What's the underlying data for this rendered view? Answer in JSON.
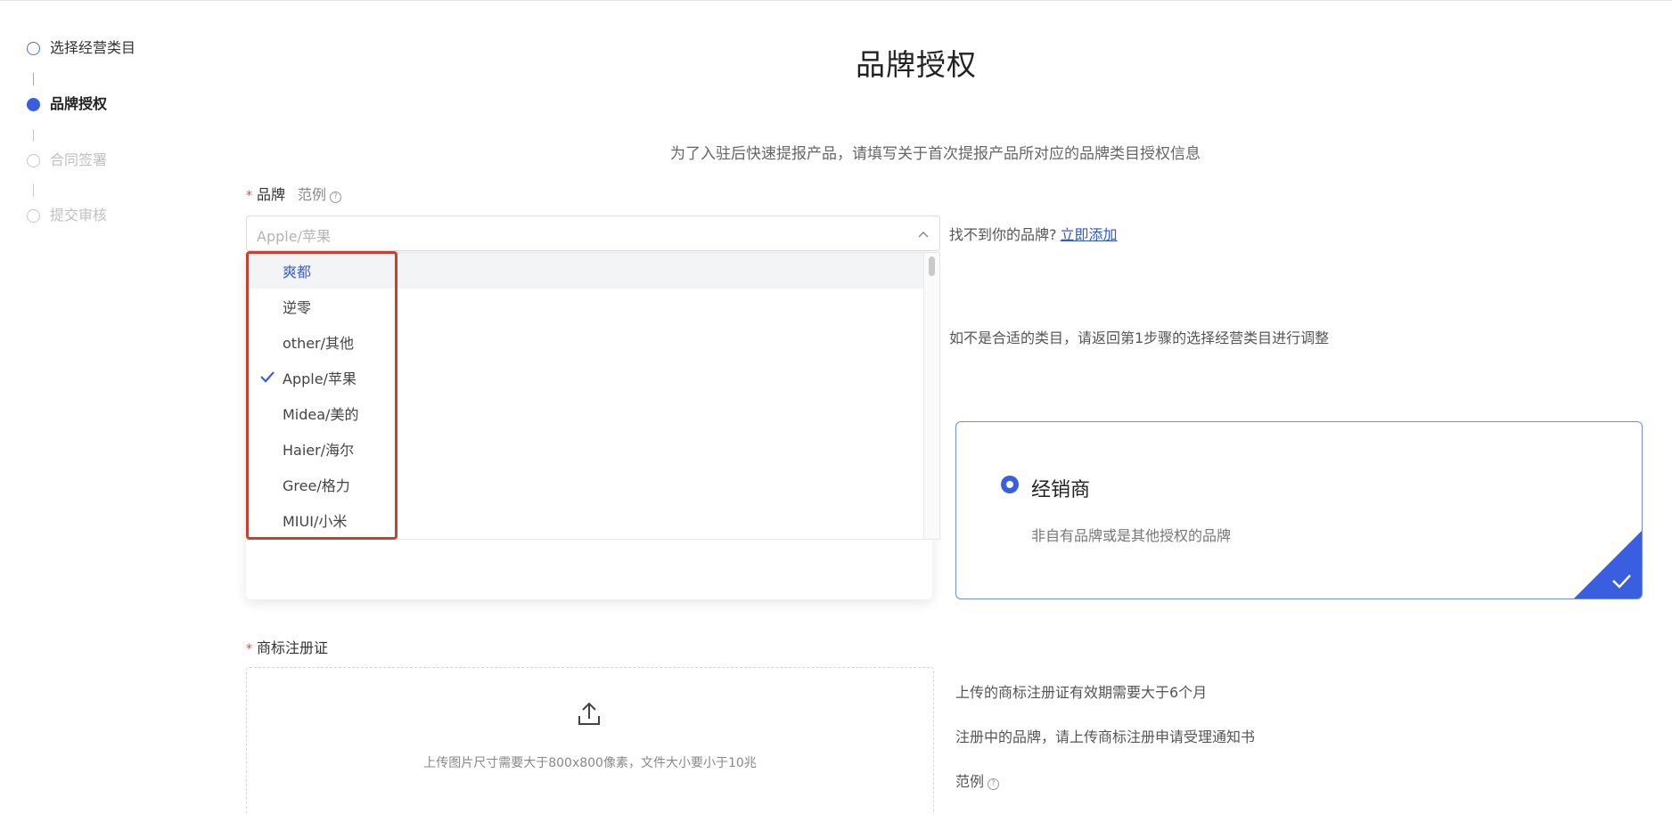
{
  "steps": [
    {
      "label": "选择经营类目",
      "state": "done"
    },
    {
      "label": "品牌授权",
      "state": "active"
    },
    {
      "label": "合同签署",
      "state": "todo"
    },
    {
      "label": "提交审核",
      "state": "todo"
    }
  ],
  "page": {
    "title": "品牌授权",
    "intro": "为了入驻后快速提报产品，请填写关于首次提报产品所对应的品牌类目授权信息"
  },
  "brand_field": {
    "required_mark": "*",
    "label": "品牌",
    "example": "范例",
    "help_icon": "question-circle-icon",
    "selected_value": "Apple/苹果",
    "not_found_text": "找不到你的品牌?",
    "add_link": "立即添加"
  },
  "dropdown": {
    "items": [
      {
        "label": "爽都",
        "state": "hover"
      },
      {
        "label": "逆零",
        "state": ""
      },
      {
        "label": "other/其他",
        "state": ""
      },
      {
        "label": "Apple/苹果",
        "state": "selected"
      },
      {
        "label": "Midea/美的",
        "state": ""
      },
      {
        "label": "Haier/海尔",
        "state": ""
      },
      {
        "label": "Gree/格力",
        "state": ""
      },
      {
        "label": "MIUI/小米",
        "state": ""
      }
    ],
    "highlight_color": "#c9402f"
  },
  "category_hint": "如不是合适的类目，请返回第1步骤的选择经营类目进行调整",
  "dealer_card": {
    "title": "经销商",
    "description": "非自有品牌或是其他授权的品牌",
    "selected": true,
    "accent_color": "#3a5ee0"
  },
  "trademark": {
    "required_mark": "*",
    "label": "商标注册证",
    "upload_icon": "upload-icon",
    "upload_text": "上传图片尺寸需要大于800x800像素，文件大小要小于10兆",
    "hints": [
      "上传的商标注册证有效期需要大于6个月",
      "注册中的品牌，请上传商标注册申请受理通知书"
    ],
    "example": "范例"
  }
}
